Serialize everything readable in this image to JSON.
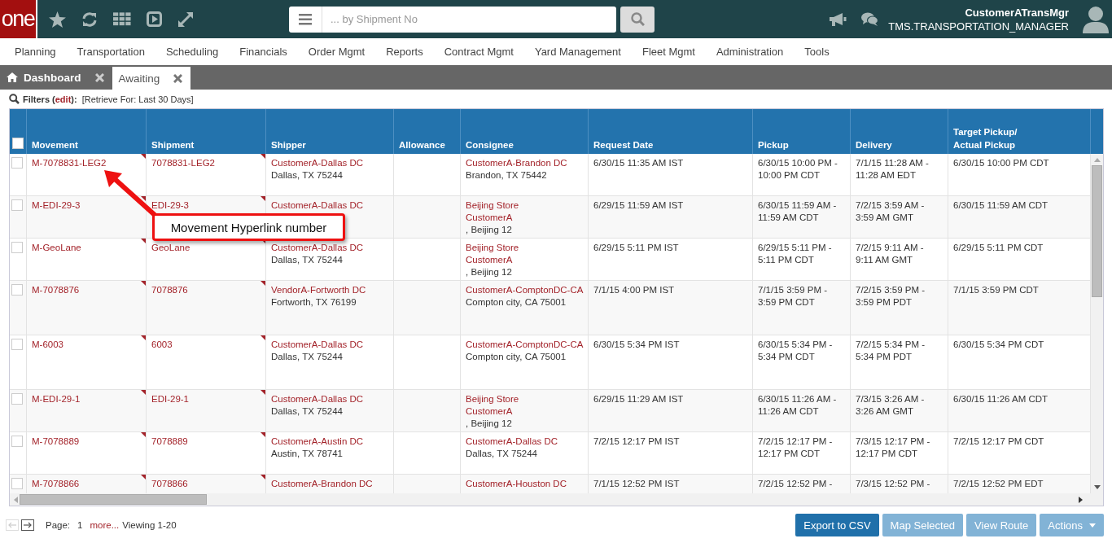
{
  "app_header": {
    "logo": "one",
    "search": {
      "placeholder": "... by Shipment No"
    },
    "user": {
      "name": "CustomerATransMgr",
      "role": "TMS.TRANSPORTATION_MANAGER"
    }
  },
  "menu": [
    "Planning",
    "Transportation",
    "Scheduling",
    "Financials",
    "Order Mgmt",
    "Reports",
    "Contract Mgmt",
    "Yard Management",
    "Fleet Mgmt",
    "Administration",
    "Tools"
  ],
  "tabs": [
    {
      "label": "Dashboard",
      "selected": false,
      "kind": "home"
    },
    {
      "label": "Awaiting",
      "selected": true,
      "kind": "plain"
    }
  ],
  "filters": {
    "prefix": "Filters (",
    "link": "edit",
    "suffix": "):",
    "criteria": "[Retrieve For: Last 30 Days]"
  },
  "table": {
    "all_selected": false,
    "columns": [
      "Movement",
      "Shipment",
      "Shipper",
      "Allowance",
      "Consignee",
      "Request Date",
      "Pickup",
      "Delivery",
      "Target Pickup/\nActual Pickup"
    ],
    "rows": [
      {
        "selected": false,
        "movement": "M-7078831-LEG2",
        "shipment": "7078831-LEG2",
        "shipper": {
          "links": [
            "CustomerA-Dallas DC"
          ],
          "address": "Dallas, TX 75244"
        },
        "consignee": {
          "links": [
            "CustomerA-Brandon DC"
          ],
          "address": "Brandon, TX 75442"
        },
        "request_date": "6/30/15 11:35 AM IST",
        "pickup": "6/30/15 10:00 PM - 10:00 PM CDT",
        "delivery": "7/1/15 11:28 AM - 11:28 AM EDT",
        "target_pickup": "6/30/15 10:00 PM CDT"
      },
      {
        "selected": false,
        "movement": "M-EDI-29-3",
        "shipment": "EDI-29-3",
        "shipper": {
          "links": [
            "CustomerA-Dallas DC"
          ]
        },
        "consignee": {
          "links": [
            "Beijing Store",
            "CustomerA"
          ],
          "address": ", Beijing 12"
        },
        "request_date": "6/29/15 11:59 AM IST",
        "pickup": "6/30/15 11:59 AM - 11:59 AM CDT",
        "delivery": "7/2/15 3:59 AM - 3:59 AM GMT",
        "target_pickup": "6/30/15 11:59 AM CDT"
      },
      {
        "selected": false,
        "movement": "M-GeoLane",
        "shipment": "GeoLane",
        "shipper": {
          "links": [
            "CustomerA-Dallas DC"
          ],
          "address": "Dallas, TX 75244"
        },
        "consignee": {
          "links": [
            "Beijing Store",
            "CustomerA"
          ],
          "address": ", Beijing 12"
        },
        "request_date": "6/29/15 5:11 PM IST",
        "pickup": "6/29/15 5:11 PM - 5:11 PM CDT",
        "delivery": "7/2/15 9:11 AM - 9:11 AM GMT",
        "target_pickup": "6/29/15 5:11 PM CDT"
      },
      {
        "selected": false,
        "movement": "M-7078876",
        "shipment": "7078876",
        "shipper": {
          "links": [
            "VendorA-Fortworth DC"
          ],
          "address": "Fortworth, TX 76199"
        },
        "consignee": {
          "links": [
            "CustomerA-ComptonDC-CA"
          ],
          "address": "Compton city, CA 75001"
        },
        "request_date": "7/1/15 4:00 PM IST",
        "pickup": "7/1/15 3:59 PM - 3:59 PM CDT",
        "delivery": "7/2/15 3:59 PM - 3:59 PM PDT",
        "target_pickup": "7/1/15 3:59 PM CDT"
      },
      {
        "selected": false,
        "movement": "M-6003",
        "shipment": "6003",
        "shipper": {
          "links": [
            "CustomerA-Dallas DC"
          ],
          "address": "Dallas, TX 75244"
        },
        "consignee": {
          "links": [
            "CustomerA-ComptonDC-CA"
          ],
          "address": "Compton city, CA 75001"
        },
        "request_date": "6/30/15 5:34 PM IST",
        "pickup": "6/30/15 5:34 PM - 5:34 PM CDT",
        "delivery": "7/2/15 5:34 PM - 5:34 PM PDT",
        "target_pickup": "6/30/15 5:34 PM CDT"
      },
      {
        "selected": false,
        "movement": "M-EDI-29-1",
        "shipment": "EDI-29-1",
        "shipper": {
          "links": [
            "CustomerA-Dallas DC"
          ],
          "address": "Dallas, TX 75244"
        },
        "consignee": {
          "links": [
            "Beijing Store",
            "CustomerA"
          ],
          "address": ", Beijing 12"
        },
        "request_date": "6/29/15 11:29 AM IST",
        "pickup": "6/30/15 11:26 AM - 11:26 AM CDT",
        "delivery": "7/3/15 3:26 AM - 3:26 AM GMT",
        "target_pickup": "6/30/15 11:26 AM CDT"
      },
      {
        "selected": false,
        "movement": "M-7078889",
        "shipment": "7078889",
        "shipper": {
          "links": [
            "CustomerA-Austin DC"
          ],
          "address": "Austin, TX 78741"
        },
        "consignee": {
          "links": [
            "CustomerA-Dallas DC"
          ],
          "address": "Dallas, TX 75244"
        },
        "request_date": "7/2/15 12:17 PM IST",
        "pickup": "7/2/15 12:17 PM - 12:17 PM CDT",
        "delivery": "7/3/15 12:17 PM - 12:17 PM CDT",
        "target_pickup": "7/2/15 12:17 PM CDT"
      },
      {
        "selected": false,
        "movement": "M-7078866",
        "shipment": "7078866",
        "shipper": {
          "links": [
            "CustomerA-Brandon DC"
          ]
        },
        "consignee": {
          "links": [
            "CustomerA-Houston DC"
          ]
        },
        "request_date": "7/1/15 12:52 PM IST",
        "pickup": "7/2/15 12:52 PM -",
        "delivery": "7/3/15 12:52 PM -",
        "target_pickup": "7/2/15 12:52 PM EDT"
      }
    ]
  },
  "pagination": {
    "prev": {
      "disabled": true
    },
    "next": {
      "disabled": false
    },
    "page_label": "Page:",
    "page": "1",
    "more": "more...",
    "viewing": "Viewing 1-20"
  },
  "buttons": [
    {
      "label": "Export to CSV",
      "disabled": false,
      "kind": "button"
    },
    {
      "label": "Map Selected",
      "disabled": true,
      "kind": "button"
    },
    {
      "label": "View Route",
      "disabled": true,
      "kind": "button"
    },
    {
      "label": "Actions",
      "disabled": true,
      "kind": "dropdown"
    }
  ],
  "callout": {
    "text": "Movement Hyperlink number"
  }
}
